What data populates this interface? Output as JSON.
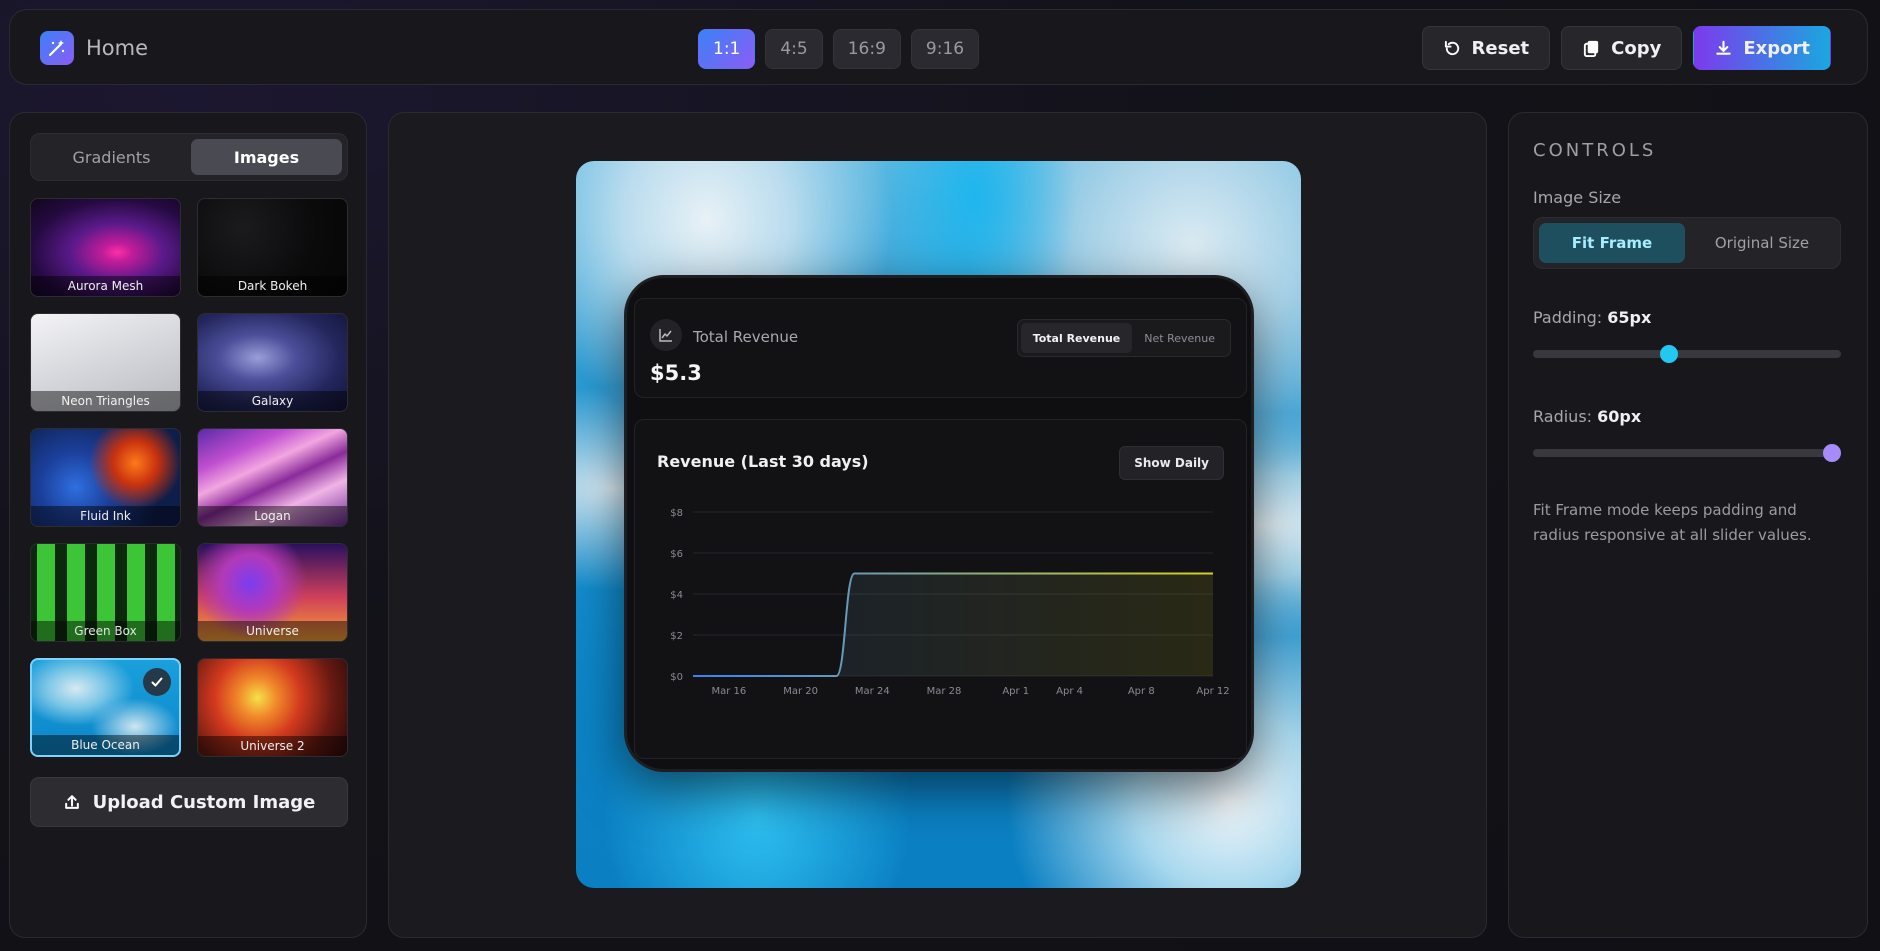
{
  "topbar": {
    "home_label": "Home",
    "ratios": [
      "1:1",
      "4:5",
      "16:9",
      "9:16"
    ],
    "active_ratio": "1:1",
    "reset_label": "Reset",
    "copy_label": "Copy",
    "export_label": "Export"
  },
  "sidebar": {
    "tabs": [
      "Gradients",
      "Images"
    ],
    "active_tab": "Images",
    "thumbnails": [
      {
        "label": "Aurora Mesh"
      },
      {
        "label": "Dark Bokeh"
      },
      {
        "label": "Neon Triangles"
      },
      {
        "label": "Galaxy"
      },
      {
        "label": "Fluid Ink"
      },
      {
        "label": "Logan"
      },
      {
        "label": "Green Box"
      },
      {
        "label": "Universe"
      },
      {
        "label": "Blue Ocean",
        "selected": true
      },
      {
        "label": "Universe 2"
      }
    ],
    "upload_label": "Upload Custom Image"
  },
  "preview": {
    "kpi": {
      "title": "Total Revenue",
      "value": "$5.3",
      "tabs": [
        "Total Revenue",
        "Net Revenue"
      ],
      "active_tab": "Total Revenue"
    },
    "chart": {
      "title": "Revenue (Last 30 days)",
      "toggle_label": "Show Daily"
    }
  },
  "chart_data": {
    "type": "area",
    "title": "Revenue (Last 30 days)",
    "y_ticks": [
      "$0",
      "$2",
      "$4",
      "$6",
      "$8"
    ],
    "x_ticks": [
      "Mar 16",
      "Mar 20",
      "Mar 24",
      "Mar 28",
      "Apr 1",
      "Apr 4",
      "Apr 8",
      "Apr 12"
    ],
    "ylim": [
      0,
      8
    ],
    "grid": true,
    "series": [
      {
        "x": [
          "Mar 14",
          "Mar 22",
          "Mar 23",
          "Apr 12"
        ],
        "values": [
          0,
          0,
          5,
          5
        ]
      }
    ],
    "colors": {
      "line_start": "#3b82f6",
      "line_end": "#d4d11a"
    }
  },
  "controls": {
    "title": "CONTROLS",
    "image_size_label": "Image Size",
    "size_options": [
      "Fit Frame",
      "Original Size"
    ],
    "active_size": "Fit Frame",
    "padding_label": "Padding:",
    "padding_value": "65px",
    "padding_fraction": 0.44,
    "radius_label": "Radius:",
    "radius_value": "60px",
    "radius_fraction": 1.0,
    "note": "Fit Frame mode keeps padding and radius responsive at all slider values."
  },
  "colors": {
    "accent_blue": "#3b82f6",
    "accent_purple": "#8b5cf6",
    "padding_knob": "#22c8f0",
    "radius_knob": "#a78bfa"
  }
}
